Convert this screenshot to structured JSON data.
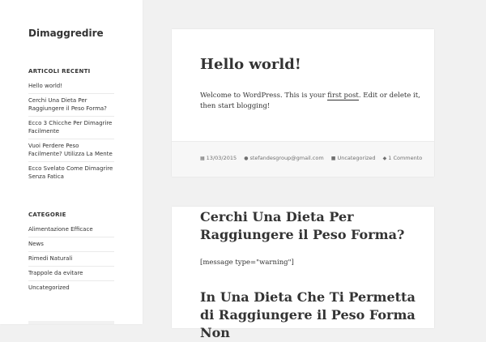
{
  "site": {
    "title": "Dimaggredire"
  },
  "sidebar": {
    "recent": {
      "title": "ARTICOLI RECENTI",
      "items": [
        "Hello world!",
        "Cerchi Una Dieta Per Raggiungere il Peso Forma?",
        "Ecco 3 Chicche Per Dimagrire Facilmente",
        "Vuoi Perdere Peso Facilmente? Utilizza La Mente",
        "Ecco Svelato Come Dimagrire Senza Fatica"
      ]
    },
    "categories": {
      "title": "CATEGORIE",
      "items": [
        "Alimentazione Efficace",
        "News",
        "Rimedi Naturali",
        "Trappole da evitare",
        "Uncategorized"
      ]
    }
  },
  "posts": [
    {
      "title": "Hello world!",
      "text_before": "Welcome to WordPress. This is your ",
      "link": "first post",
      "text_after": ". Edit or delete it, then start blogging!",
      "meta": {
        "date": "13/03/2015",
        "author": "stefandesgroup@gmail.com",
        "category": "Uncategorized",
        "comments": "1 Commento"
      }
    },
    {
      "title": "Cerchi Una Dieta Per Raggiungere il Peso Forma?",
      "text": "[message type=\"warning\"]",
      "heading": "In Una Dieta Che Ti Permetta di Raggiungere il Peso Forma Non"
    }
  ],
  "icons": {
    "date": "calendar-icon",
    "author": "user-icon",
    "category": "folder-icon",
    "comments": "comment-icon"
  }
}
